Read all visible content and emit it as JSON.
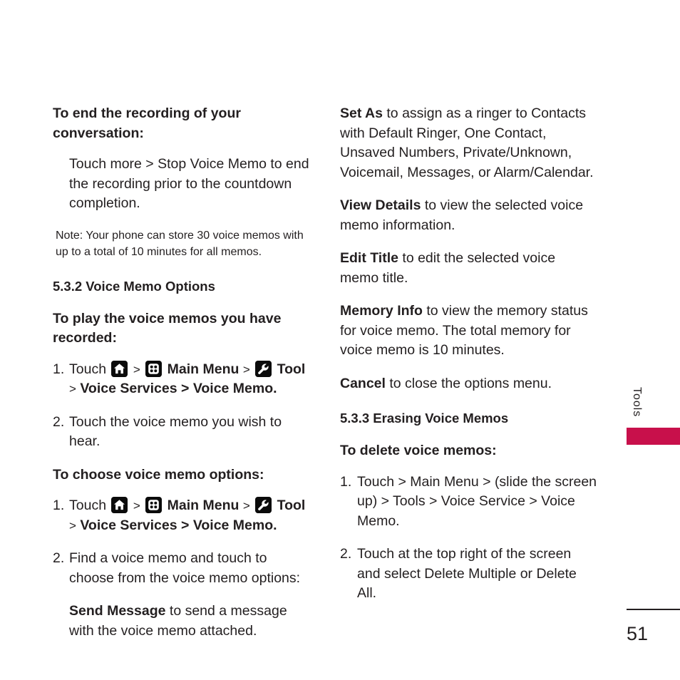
{
  "document": {
    "page_number": "51",
    "side_tab_label": "Tools",
    "accent_color": "#c8104b",
    "text_color": "#231f20",
    "background_color": "#ffffff"
  },
  "icons": {
    "home": "home-icon",
    "grid": "main-menu-grid-icon",
    "wrench": "tool-wrench-icon",
    "separator": ">"
  },
  "left_column": {
    "heading_1": "To end the recording of your conversation:",
    "body_1": "Touch more > Stop Voice Memo to end the recording prior to the countdown completion.",
    "note": "Note: Your phone can store 30 voice memos with up to a total of 10 minutes for all memos.",
    "section_heading": "5.3.2 Voice Memo Options",
    "heading_2": "To play the voice memos you have recorded:",
    "step_1": {
      "number": "1.",
      "text_before_home": "Touch",
      "text_after_home": "",
      "main_menu_label": "Main Menu",
      "tool_label": "Tool",
      "tail": "Voice Services > Voice Memo."
    },
    "step_2": {
      "number": "2.",
      "text": "Touch the voice memo you wish to hear."
    },
    "heading_3": "To choose voice memo options:",
    "step_3": {
      "number": "1.",
      "text_before_home": "Touch",
      "main_menu_label": "Main Menu",
      "tool_label": "Tool",
      "tail": "Voice Services > Voice Memo."
    },
    "step_4": {
      "number": "2.",
      "text": "Find a voice memo and touch to choose from the voice memo options:"
    },
    "option_send_message": {
      "term": "Send Message",
      "description": " to send a message with the voice memo attached."
    }
  },
  "right_column": {
    "option_set_as": {
      "term": "Set As",
      "description": " to assign as a ringer to Contacts with Default Ringer, One Contact, Unsaved Numbers, Private/Unknown, Voicemail, Messages, or Alarm/Calendar."
    },
    "option_view_details": {
      "term": "View Details",
      "description": " to view the selected voice memo information."
    },
    "option_edit_title": {
      "term": "Edit Title",
      "description": " to edit the selected voice memo title."
    },
    "option_memory_info": {
      "term": "Memory Info",
      "description": " to view the memory status for voice memo. The total memory for voice memo is 10 minutes."
    },
    "option_cancel": {
      "term": "Cancel",
      "description": " to close the options menu."
    },
    "section_heading": "5.3.3 Erasing Voice Memos",
    "heading_1": "To delete voice memos:",
    "step_1": {
      "number": "1.",
      "text": "Touch > Main Menu > (slide the screen up) > Tools > Voice Service > Voice Memo."
    },
    "step_2": {
      "number": "2.",
      "text": "Touch at the top right of the screen and select Delete Multiple or Delete All."
    }
  }
}
